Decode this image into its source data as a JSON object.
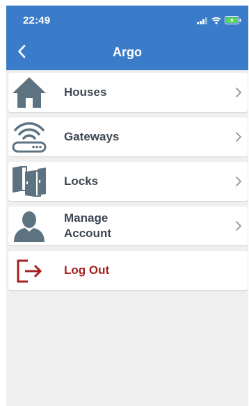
{
  "status_bar": {
    "time": "22:49",
    "icons": [
      "signal-icon",
      "wifi-icon",
      "battery-charging-icon"
    ]
  },
  "header": {
    "title": "Argo",
    "back_icon": "chevron-left-icon"
  },
  "menu": {
    "items": [
      {
        "label": "Houses",
        "icon": "house-icon",
        "has_chevron": true
      },
      {
        "label": "Gateways",
        "icon": "router-wifi-icon",
        "has_chevron": true
      },
      {
        "label": "Locks",
        "icon": "doors-icon",
        "has_chevron": true
      },
      {
        "label": "Manage\nAccount",
        "icon": "user-icon",
        "has_chevron": true
      },
      {
        "label": "Log Out",
        "icon": "logout-icon",
        "has_chevron": false
      }
    ]
  },
  "colors": {
    "header_bg": "#3a7cca",
    "screen_bg": "#efefef",
    "icon_gray": "#5e7382",
    "label_dark": "#3d4752",
    "logout_red": "#a51f1f",
    "battery_green": "#5ad363"
  }
}
